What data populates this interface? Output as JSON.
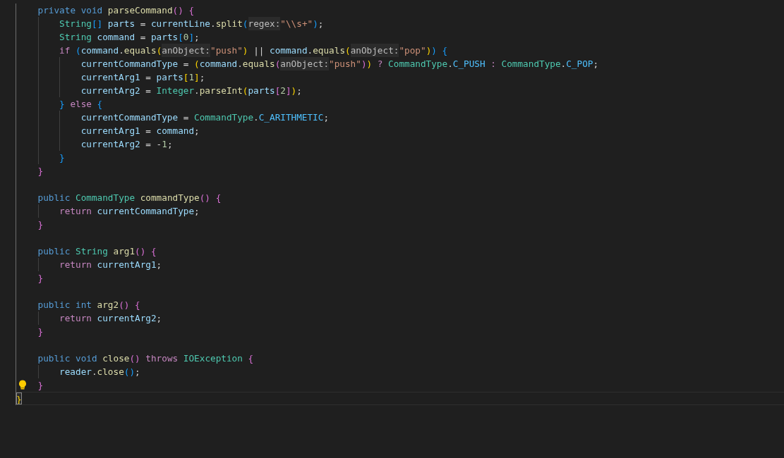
{
  "editor": {
    "lines": [
      {
        "kind": "level1",
        "current": false,
        "lightbulb": false,
        "tokens": [
          {
            "kind": "kw",
            "text": "private void "
          },
          {
            "kind": "fn",
            "text": "parseCommand"
          },
          {
            "kind": "b2",
            "text": "() "
          },
          {
            "kind": "b2",
            "text": "{"
          }
        ]
      },
      {
        "kind": "level2",
        "current": false,
        "lightbulb": false,
        "tokens": [
          {
            "kind": "type",
            "text": "String"
          },
          {
            "kind": "b3",
            "text": "[]"
          },
          {
            "kind": "var",
            "text": " parts"
          },
          {
            "kind": "op",
            "text": " = "
          },
          {
            "kind": "var",
            "text": "currentLine"
          },
          {
            "kind": "op",
            "text": "."
          },
          {
            "kind": "fn",
            "text": "split"
          },
          {
            "kind": "b3",
            "text": "("
          },
          {
            "kind": "hint",
            "text": "regex:"
          },
          {
            "kind": "str",
            "text": "\"\\\\s+\""
          },
          {
            "kind": "b3",
            "text": ")"
          },
          {
            "kind": "op",
            "text": ";"
          }
        ]
      },
      {
        "kind": "level2",
        "current": false,
        "lightbulb": false,
        "tokens": [
          {
            "kind": "type",
            "text": "String"
          },
          {
            "kind": "var",
            "text": " command"
          },
          {
            "kind": "op",
            "text": " = "
          },
          {
            "kind": "var",
            "text": "parts"
          },
          {
            "kind": "b3",
            "text": "["
          },
          {
            "kind": "num",
            "text": "0"
          },
          {
            "kind": "b3",
            "text": "]"
          },
          {
            "kind": "op",
            "text": ";"
          }
        ]
      },
      {
        "kind": "level2",
        "current": false,
        "lightbulb": false,
        "tokens": [
          {
            "kind": "ctl",
            "text": "if "
          },
          {
            "kind": "b3",
            "text": "("
          },
          {
            "kind": "var",
            "text": "command"
          },
          {
            "kind": "op",
            "text": "."
          },
          {
            "kind": "fn",
            "text": "equals"
          },
          {
            "kind": "b1",
            "text": "("
          },
          {
            "kind": "hint",
            "text": "anObject:"
          },
          {
            "kind": "str",
            "text": "\"push\""
          },
          {
            "kind": "b1",
            "text": ")"
          },
          {
            "kind": "op",
            "text": " || "
          },
          {
            "kind": "var",
            "text": "command"
          },
          {
            "kind": "op",
            "text": "."
          },
          {
            "kind": "fn",
            "text": "equals"
          },
          {
            "kind": "b1",
            "text": "("
          },
          {
            "kind": "hint",
            "text": "anObject:"
          },
          {
            "kind": "str",
            "text": "\"pop\""
          },
          {
            "kind": "b1",
            "text": ")"
          },
          {
            "kind": "b3",
            "text": ") "
          },
          {
            "kind": "b3",
            "text": "{"
          }
        ]
      },
      {
        "kind": "level3",
        "current": false,
        "lightbulb": false,
        "tokens": [
          {
            "kind": "var",
            "text": "currentCommandType"
          },
          {
            "kind": "op",
            "text": " = "
          },
          {
            "kind": "b1",
            "text": "("
          },
          {
            "kind": "var",
            "text": "command"
          },
          {
            "kind": "op",
            "text": "."
          },
          {
            "kind": "fn",
            "text": "equals"
          },
          {
            "kind": "b2",
            "text": "("
          },
          {
            "kind": "hint",
            "text": "anObject:"
          },
          {
            "kind": "str",
            "text": "\"push\""
          },
          {
            "kind": "b2",
            "text": ")"
          },
          {
            "kind": "b1",
            "text": ")"
          },
          {
            "kind": "ctl",
            "text": " ? "
          },
          {
            "kind": "type",
            "text": "CommandType"
          },
          {
            "kind": "op",
            "text": "."
          },
          {
            "kind": "const",
            "text": "C_PUSH"
          },
          {
            "kind": "ctl",
            "text": " : "
          },
          {
            "kind": "type",
            "text": "CommandType"
          },
          {
            "kind": "op",
            "text": "."
          },
          {
            "kind": "const",
            "text": "C_POP"
          },
          {
            "kind": "op",
            "text": ";"
          }
        ]
      },
      {
        "kind": "level3",
        "current": false,
        "lightbulb": false,
        "tokens": [
          {
            "kind": "var",
            "text": "currentArg1"
          },
          {
            "kind": "op",
            "text": " = "
          },
          {
            "kind": "var",
            "text": "parts"
          },
          {
            "kind": "b1",
            "text": "["
          },
          {
            "kind": "num",
            "text": "1"
          },
          {
            "kind": "b1",
            "text": "]"
          },
          {
            "kind": "op",
            "text": ";"
          }
        ]
      },
      {
        "kind": "level3",
        "current": false,
        "lightbulb": false,
        "tokens": [
          {
            "kind": "var",
            "text": "currentArg2"
          },
          {
            "kind": "op",
            "text": " = "
          },
          {
            "kind": "type",
            "text": "Integer"
          },
          {
            "kind": "op",
            "text": "."
          },
          {
            "kind": "fn",
            "text": "parseInt"
          },
          {
            "kind": "b1",
            "text": "("
          },
          {
            "kind": "var",
            "text": "parts"
          },
          {
            "kind": "b2",
            "text": "["
          },
          {
            "kind": "num",
            "text": "2"
          },
          {
            "kind": "b2",
            "text": "]"
          },
          {
            "kind": "b1",
            "text": ")"
          },
          {
            "kind": "op",
            "text": ";"
          }
        ]
      },
      {
        "kind": "level2",
        "current": false,
        "lightbulb": false,
        "tokens": [
          {
            "kind": "b3",
            "text": "} "
          },
          {
            "kind": "ctl",
            "text": "else "
          },
          {
            "kind": "b3",
            "text": "{"
          }
        ]
      },
      {
        "kind": "level3",
        "current": false,
        "lightbulb": false,
        "tokens": [
          {
            "kind": "var",
            "text": "currentCommandType"
          },
          {
            "kind": "op",
            "text": " = "
          },
          {
            "kind": "type",
            "text": "CommandType"
          },
          {
            "kind": "op",
            "text": "."
          },
          {
            "kind": "const",
            "text": "C_ARITHMETIC"
          },
          {
            "kind": "op",
            "text": ";"
          }
        ]
      },
      {
        "kind": "level3",
        "current": false,
        "lightbulb": false,
        "tokens": [
          {
            "kind": "var",
            "text": "currentArg1"
          },
          {
            "kind": "op",
            "text": " = "
          },
          {
            "kind": "var",
            "text": "command"
          },
          {
            "kind": "op",
            "text": ";"
          }
        ]
      },
      {
        "kind": "level3",
        "current": false,
        "lightbulb": false,
        "tokens": [
          {
            "kind": "var",
            "text": "currentArg2"
          },
          {
            "kind": "op",
            "text": " = -"
          },
          {
            "kind": "num",
            "text": "1"
          },
          {
            "kind": "op",
            "text": ";"
          }
        ]
      },
      {
        "kind": "level2",
        "current": false,
        "lightbulb": false,
        "tokens": [
          {
            "kind": "b3",
            "text": "}"
          }
        ]
      },
      {
        "kind": "level1",
        "current": false,
        "lightbulb": false,
        "tokens": [
          {
            "kind": "b2",
            "text": "}"
          }
        ]
      },
      {
        "kind": "blank",
        "current": false,
        "lightbulb": false
      },
      {
        "kind": "level1",
        "current": false,
        "lightbulb": false,
        "tokens": [
          {
            "kind": "kw",
            "text": "public "
          },
          {
            "kind": "type",
            "text": "CommandType "
          },
          {
            "kind": "fn",
            "text": "commandType"
          },
          {
            "kind": "b2",
            "text": "() "
          },
          {
            "kind": "b2",
            "text": "{"
          }
        ]
      },
      {
        "kind": "level2",
        "current": false,
        "lightbulb": false,
        "tokens": [
          {
            "kind": "ctl",
            "text": "return"
          },
          {
            "kind": "var",
            "text": " currentCommandType"
          },
          {
            "kind": "op",
            "text": ";"
          }
        ]
      },
      {
        "kind": "level1",
        "current": false,
        "lightbulb": false,
        "tokens": [
          {
            "kind": "b2",
            "text": "}"
          }
        ]
      },
      {
        "kind": "blank",
        "current": false,
        "lightbulb": false
      },
      {
        "kind": "level1",
        "current": false,
        "lightbulb": false,
        "tokens": [
          {
            "kind": "kw",
            "text": "public "
          },
          {
            "kind": "type",
            "text": "String "
          },
          {
            "kind": "fn",
            "text": "arg1"
          },
          {
            "kind": "b2",
            "text": "() "
          },
          {
            "kind": "b2",
            "text": "{"
          }
        ]
      },
      {
        "kind": "level2",
        "current": false,
        "lightbulb": false,
        "tokens": [
          {
            "kind": "ctl",
            "text": "return"
          },
          {
            "kind": "var",
            "text": " currentArg1"
          },
          {
            "kind": "op",
            "text": ";"
          }
        ]
      },
      {
        "kind": "level1",
        "current": false,
        "lightbulb": false,
        "tokens": [
          {
            "kind": "b2",
            "text": "}"
          }
        ]
      },
      {
        "kind": "blank",
        "current": false,
        "lightbulb": false
      },
      {
        "kind": "level1",
        "current": false,
        "lightbulb": false,
        "tokens": [
          {
            "kind": "kw",
            "text": "public int "
          },
          {
            "kind": "fn",
            "text": "arg2"
          },
          {
            "kind": "b2",
            "text": "() "
          },
          {
            "kind": "b2",
            "text": "{"
          }
        ]
      },
      {
        "kind": "level2",
        "current": false,
        "lightbulb": false,
        "tokens": [
          {
            "kind": "ctl",
            "text": "return"
          },
          {
            "kind": "var",
            "text": " currentArg2"
          },
          {
            "kind": "op",
            "text": ";"
          }
        ]
      },
      {
        "kind": "level1",
        "current": false,
        "lightbulb": false,
        "tokens": [
          {
            "kind": "b2",
            "text": "}"
          }
        ]
      },
      {
        "kind": "blank",
        "current": false,
        "lightbulb": false
      },
      {
        "kind": "level1",
        "current": false,
        "lightbulb": false,
        "tokens": [
          {
            "kind": "kw",
            "text": "public void "
          },
          {
            "kind": "fn",
            "text": "close"
          },
          {
            "kind": "b2",
            "text": "() "
          },
          {
            "kind": "ctl",
            "text": "throws "
          },
          {
            "kind": "type",
            "text": "IOException "
          },
          {
            "kind": "b2",
            "text": "{"
          }
        ]
      },
      {
        "kind": "level2",
        "current": false,
        "lightbulb": false,
        "tokens": [
          {
            "kind": "var",
            "text": "reader"
          },
          {
            "kind": "op",
            "text": "."
          },
          {
            "kind": "fn",
            "text": "close"
          },
          {
            "kind": "b3",
            "text": "()"
          },
          {
            "kind": "op",
            "text": ";"
          }
        ]
      },
      {
        "kind": "level1",
        "current": false,
        "lightbulb": true,
        "tokens": [
          {
            "kind": "b2",
            "text": "}"
          }
        ]
      },
      {
        "kind": "top",
        "current": true,
        "lightbulb": false,
        "tokens": [
          {
            "kind": "b1m",
            "text": "}"
          }
        ]
      }
    ]
  }
}
